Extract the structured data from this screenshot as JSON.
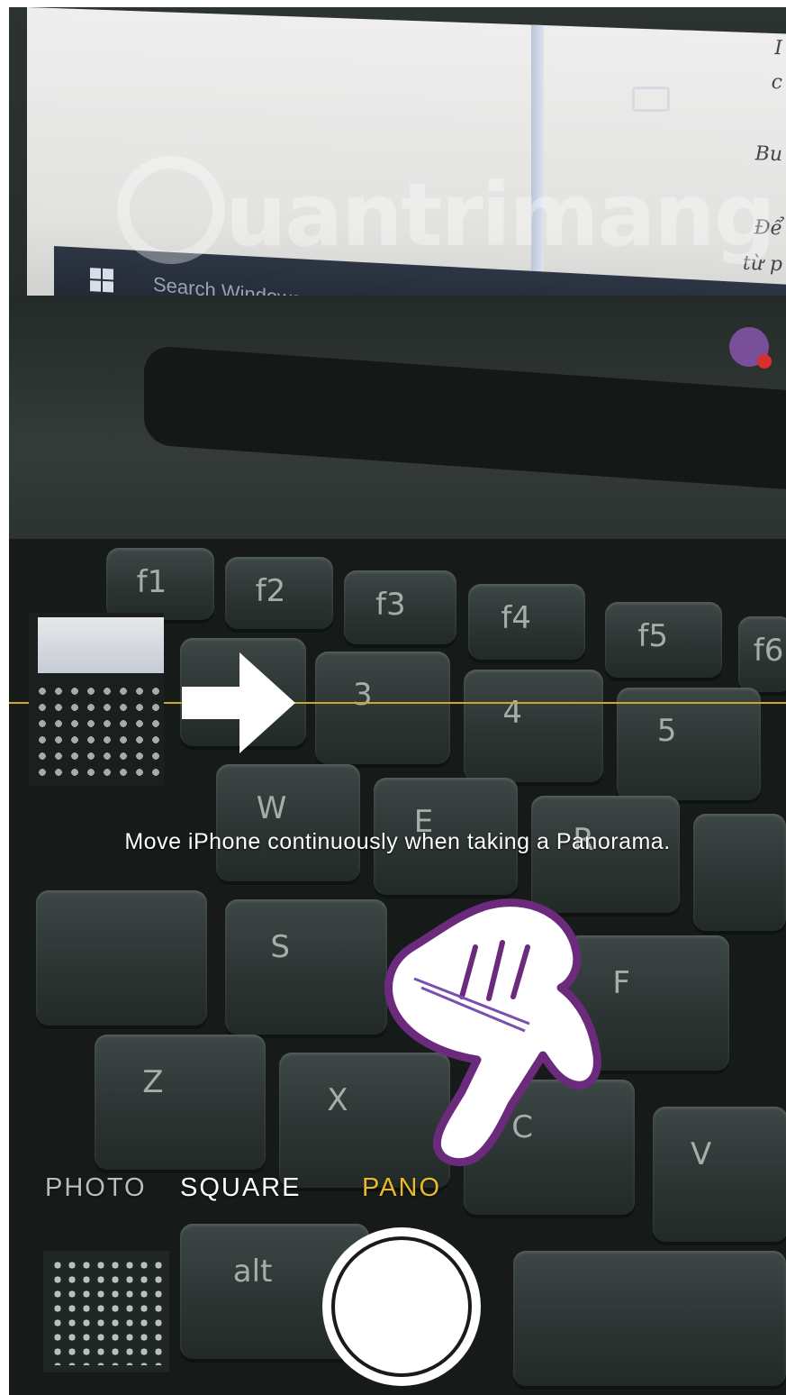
{
  "camera": {
    "modes": [
      {
        "label": "PHOTO",
        "state": "dim"
      },
      {
        "label": "SQUARE",
        "state": "normal"
      },
      {
        "label": "PANO",
        "state": "active"
      }
    ],
    "instruction": "Move iPhone continuously when taking a Panorama.",
    "accent_color": "#e8b92a",
    "guide_line_color": "#c9a92a"
  },
  "background_laptop": {
    "taskbar_search_text": "Search Windows",
    "doc_text_fragments": [
      "I",
      "c",
      "Bu",
      "Để",
      "từ p"
    ],
    "keys": [
      "f1",
      "f2",
      "f3",
      "f4",
      "f5",
      "f6",
      "#",
      "3",
      "$",
      "4",
      "%",
      "5",
      "W",
      "E",
      "R",
      "S",
      "F",
      "Z",
      "X",
      "C",
      "V",
      "alt"
    ]
  },
  "watermark": {
    "text": "uantrimang"
  },
  "icons": [
    "windows-logo-icon",
    "task-view-icon",
    "viber-app-icon",
    "pano-direction-arrow-icon",
    "pointing-hand-icon",
    "shutter-icon"
  ]
}
